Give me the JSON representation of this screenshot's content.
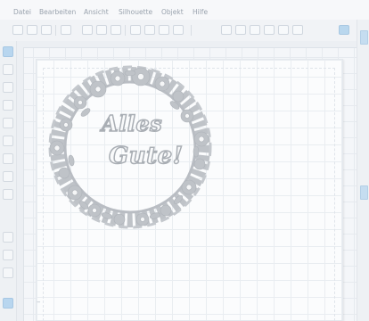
{
  "menubar": {
    "items": [
      "Datei",
      "Bearbeiten",
      "Ansicht",
      "Silhouette",
      "Objekt",
      "Hilfe"
    ]
  },
  "design": {
    "text_line1": "Alles",
    "text_line2": "Gute!"
  },
  "zoom_control": {
    "minus_label": "–"
  },
  "colors": {
    "accent": "#b8d6ef",
    "design_fill": "#bfc3c8",
    "grid": "#e6eaef"
  },
  "icons": {
    "toolbar": [
      "new-file-icon",
      "open-icon",
      "save-icon",
      "print-icon",
      "cut-icon",
      "copy-icon",
      "paste-icon",
      "undo-icon",
      "redo-icon",
      "pointer-icon",
      "zoom-in-icon",
      "zoom-out-icon",
      "zoom-fit-icon",
      "pan-icon"
    ],
    "sidebar": [
      "select-tool-icon",
      "edit-points-icon",
      "line-tool-icon",
      "rectangle-tool-icon",
      "ellipse-tool-icon",
      "polygon-tool-icon",
      "curve-tool-icon",
      "freehand-tool-icon",
      "text-tool-icon",
      "eraser-tool-icon",
      "knife-tool-icon"
    ]
  }
}
